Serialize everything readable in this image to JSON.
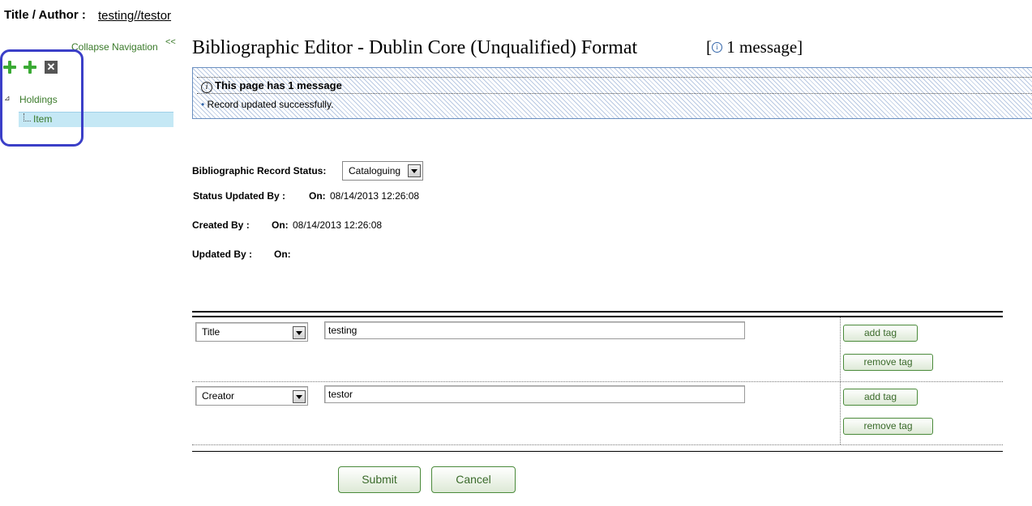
{
  "header": {
    "title_author_label": "Title / Author :",
    "title_author_value": "testing//testor"
  },
  "nav": {
    "collapse_label": "Collapse Navigation",
    "collapse_arrows": "<<",
    "icons": [
      "add-icon",
      "add-icon",
      "delete-icon"
    ],
    "delete_glyph": "✕",
    "tree": {
      "expand_glyph": "⊿",
      "holdings": "Holdings",
      "item": "Item"
    }
  },
  "main": {
    "title": "Bibliographic Editor - Dublin Core (Unqualified) Format",
    "message_count": {
      "open": "[",
      "info_glyph": "i",
      "text": "1 message]"
    },
    "message_box": {
      "info_glyph": "i",
      "heading": "This page has 1 message",
      "bullet": "•",
      "message": "Record updated successfully."
    },
    "status": {
      "label": "Bibliographic Record Status:",
      "value": "Cataloguing"
    },
    "status_updated": {
      "label": "Status Updated By :",
      "on_label": "On:",
      "date": "08/14/2013 12:26:08"
    },
    "created": {
      "label": "Created By :",
      "on_label": "On:",
      "date": "08/14/2013 12:26:08"
    },
    "updated": {
      "label": "Updated By :",
      "on_label": "On:"
    }
  },
  "tags": [
    {
      "field": "Title",
      "value": "testing",
      "add_label": "add tag",
      "remove_label": "remove tag"
    },
    {
      "field": "Creator",
      "value": "testor",
      "add_label": "add tag",
      "remove_label": "remove tag"
    }
  ],
  "actions": {
    "submit": "Submit",
    "cancel": "Cancel"
  },
  "colors": {
    "nav_green": "#3a7a2a",
    "highlight": "#3b3fc8",
    "item_selected": "#c5e8f5",
    "message_stripe": "#b9c9e2"
  }
}
